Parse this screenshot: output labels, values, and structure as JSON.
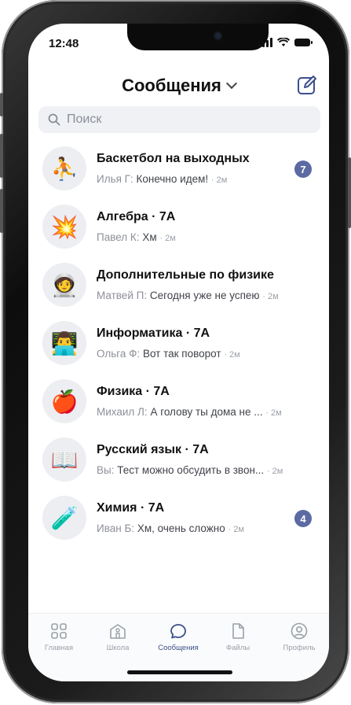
{
  "status": {
    "time": "12:48"
  },
  "header": {
    "title": "Сообщения"
  },
  "search": {
    "placeholder": "Поиск"
  },
  "chats": [
    {
      "name": "Баскетбол на выходных",
      "author": "Илья Г:",
      "message": "Конечно идем!",
      "ago": "2м",
      "badge": "7",
      "avatar": "basketball-player-icon",
      "emoji": "⛹"
    },
    {
      "name": "Алгебра · 7А",
      "author": "Павел К:",
      "message": "Хм",
      "ago": "2м",
      "badge": "",
      "avatar": "explosion-icon",
      "emoji": "💥"
    },
    {
      "name": "Дополнительные по физике",
      "author": "Матвей П:",
      "message": "Сегодня уже не успею",
      "ago": "2м",
      "badge": "",
      "avatar": "astronaut-icon",
      "emoji": "🧑‍🚀"
    },
    {
      "name": "Информатика · 7А",
      "author": "Ольга Ф:",
      "message": "Вот так поворот",
      "ago": "2м",
      "badge": "",
      "avatar": "technologist-icon",
      "emoji": "👨‍💻"
    },
    {
      "name": "Физика · 7А",
      "author": "Михаил Л:",
      "message": "А голову ты дома не ...",
      "ago": "2м",
      "badge": "",
      "avatar": "apple-icon",
      "emoji": "🍎"
    },
    {
      "name": "Русский язык · 7А",
      "author": "Вы:",
      "message": "Тест можно обсудить в звон...",
      "ago": "2м",
      "badge": "",
      "avatar": "open-book-icon",
      "emoji": "📖"
    },
    {
      "name": "Химия · 7А",
      "author": "Иван Б:",
      "message": "Хм, очень сложно",
      "ago": "2м",
      "badge": "4",
      "avatar": "test-tube-icon",
      "emoji": "🧪"
    }
  ],
  "tabs": [
    {
      "label": "Главная",
      "icon": "grid-icon"
    },
    {
      "label": "Школа",
      "icon": "school-icon"
    },
    {
      "label": "Сообщения",
      "icon": "chat-bubble-icon"
    },
    {
      "label": "Файлы",
      "icon": "file-icon"
    },
    {
      "label": "Профиль",
      "icon": "profile-icon"
    }
  ],
  "colors": {
    "accent": "#3d4f8a",
    "badge": "#5c6aa3",
    "searchBg": "#eff1f4"
  }
}
